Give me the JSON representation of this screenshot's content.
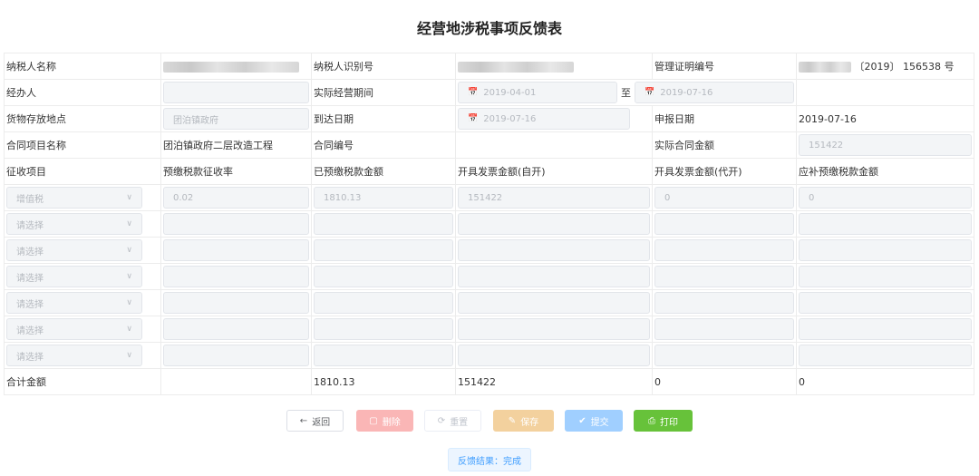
{
  "title": "经营地涉税事项反馈表",
  "labels": {
    "taxpayer_name": "纳税人名称",
    "taxpayer_id": "纳税人识别号",
    "cert_no": "管理证明编号",
    "handler": "经办人",
    "period": "实际经营期间",
    "storage": "货物存放地点",
    "arrival": "到达日期",
    "declare_date": "申报日期",
    "contract_name": "合同项目名称",
    "contract_no": "合同编号",
    "contract_amount": "实际合同金额",
    "levy_item": "征收项目",
    "prepaid_rate": "预缴税款征收率",
    "prepaid_amount": "已预缴税款金额",
    "invoice_self": "开具发票金额(自开)",
    "invoice_agent": "开具发票金额(代开)",
    "due_amount": "应补预缴税款金额",
    "total": "合计金额"
  },
  "values": {
    "cert_no_suffix": "〔2019〕 156538 号",
    "period_sep": "至",
    "period_start": "2019-04-01",
    "period_end": "2019-07-16",
    "storage": "团泊镇政府",
    "arrival": "2019-07-16",
    "declare_date": "2019-07-16",
    "contract_name": "团泊镇政府二层改造工程",
    "contract_amount": "151422"
  },
  "rows": [
    {
      "item": "增值税",
      "rate": "0.02",
      "prepaid": "1810.13",
      "self": "151422",
      "agent": "0",
      "due": "0"
    },
    {
      "item": "请选择",
      "rate": "",
      "prepaid": "",
      "self": "",
      "agent": "",
      "due": ""
    },
    {
      "item": "请选择",
      "rate": "",
      "prepaid": "",
      "self": "",
      "agent": "",
      "due": ""
    },
    {
      "item": "请选择",
      "rate": "",
      "prepaid": "",
      "self": "",
      "agent": "",
      "due": ""
    },
    {
      "item": "请选择",
      "rate": "",
      "prepaid": "",
      "self": "",
      "agent": "",
      "due": ""
    },
    {
      "item": "请选择",
      "rate": "",
      "prepaid": "",
      "self": "",
      "agent": "",
      "due": ""
    },
    {
      "item": "请选择",
      "rate": "",
      "prepaid": "",
      "self": "",
      "agent": "",
      "due": ""
    }
  ],
  "totals": {
    "prepaid": "1810.13",
    "self": "151422",
    "agent": "0",
    "due": "0"
  },
  "buttons": {
    "back": "返回",
    "delete": "删除",
    "reset": "重置",
    "save": "保存",
    "submit": "提交",
    "print": "打印"
  },
  "status": "反馈结果：完成",
  "icons": {
    "back": "arrow-left-icon",
    "delete": "trash-icon",
    "reset": "refresh-icon",
    "save": "edit-icon",
    "submit": "check-circle-icon",
    "print": "printer-icon",
    "date": "calendar-icon",
    "select": "chevron-down-icon"
  },
  "colors": {
    "delete": "#fab6b6",
    "save": "#f3d19e",
    "submit": "#a0cfff",
    "print": "#67c23a",
    "status_text": "#409eff"
  }
}
